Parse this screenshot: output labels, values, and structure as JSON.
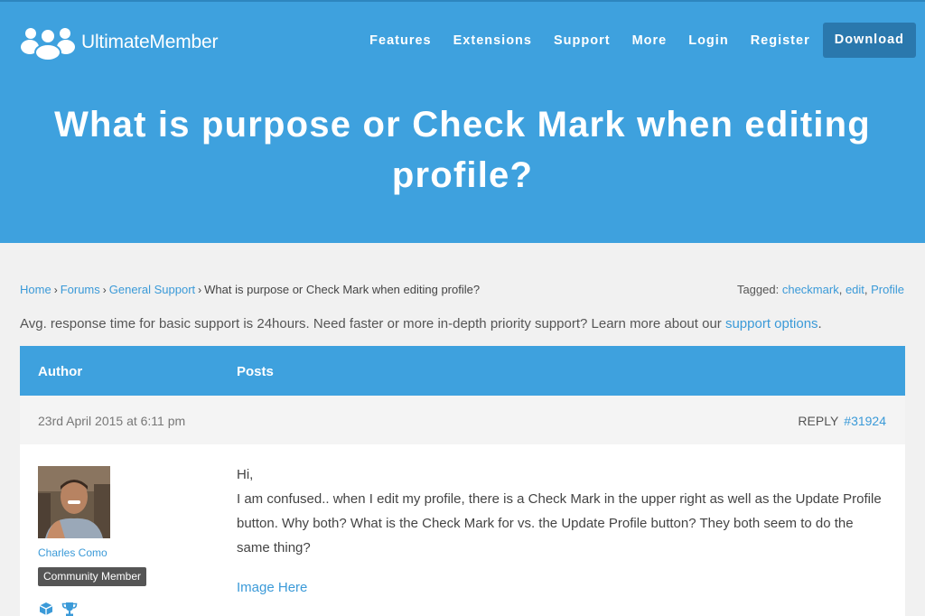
{
  "header": {
    "logo_text": "UltimateMember",
    "nav": [
      "Features",
      "Extensions",
      "Support",
      "More",
      "Login",
      "Register"
    ],
    "download_label": "Download"
  },
  "page": {
    "title": "What is purpose or Check Mark when editing profile?"
  },
  "breadcrumb": {
    "items": [
      "Home",
      "Forums",
      "General Support"
    ],
    "current": "What is purpose or Check Mark when editing profile?"
  },
  "tags": {
    "label": "Tagged:",
    "items": [
      "checkmark",
      "edit",
      "Profile"
    ]
  },
  "notice": {
    "text": "Avg. response time for basic support is 24hours. Need faster or more in-depth priority support? Learn more about our ",
    "link": "support options",
    "end": "."
  },
  "table": {
    "col_author": "Author",
    "col_posts": "Posts"
  },
  "post": {
    "date": "23rd April 2015 at 6:11 pm",
    "reply_label": "REPLY",
    "post_id": "#31924",
    "author": "Charles Como",
    "role": "Community Member",
    "greeting": "Hi,",
    "body": "I am confused.. when I edit my profile, there is a Check Mark in the upper right as well as the Update Profile button. Why both? What is the Check Mark for vs. the Update Profile button? They both seem to do the same thing?",
    "link": "Image Here"
  },
  "colors": {
    "brand_blue": "#3ea1de",
    "download_button": "#2a78ad",
    "link": "#3b9ad8",
    "badge": "#555555"
  }
}
